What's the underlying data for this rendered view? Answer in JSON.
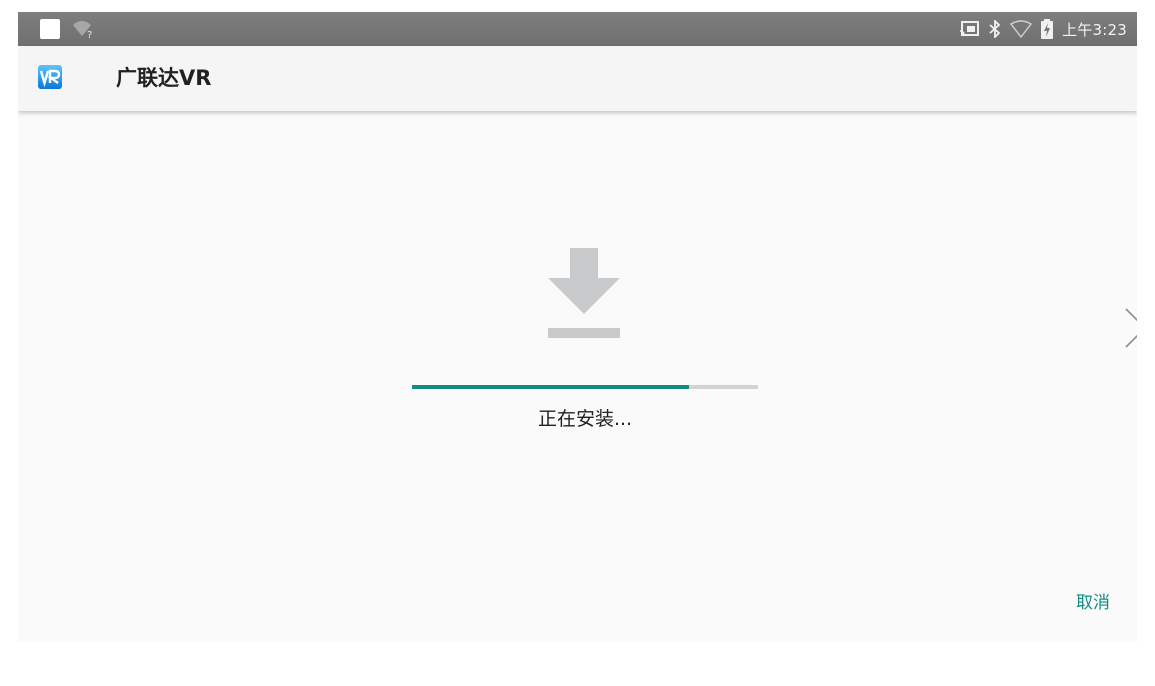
{
  "status_bar": {
    "time": "上午3:23",
    "icons": [
      "notification-icon",
      "wifi-question-icon",
      "cast-icon",
      "bluetooth-icon",
      "wifi-icon",
      "battery-charging-icon"
    ]
  },
  "app_bar": {
    "title": "广联达VR",
    "icon": "vr-app-icon"
  },
  "install": {
    "icon": "download-icon",
    "progress_fraction": 0.8,
    "status_text": "正在安装..."
  },
  "actions": {
    "cancel_label": "取消",
    "next_icon": "chevron-right-icon"
  },
  "colors": {
    "accent": "#128b83",
    "status_bar": "#777777",
    "app_bar": "#f5f5f5",
    "background": "#fafafa",
    "icon_gray": "#c8cacc"
  }
}
